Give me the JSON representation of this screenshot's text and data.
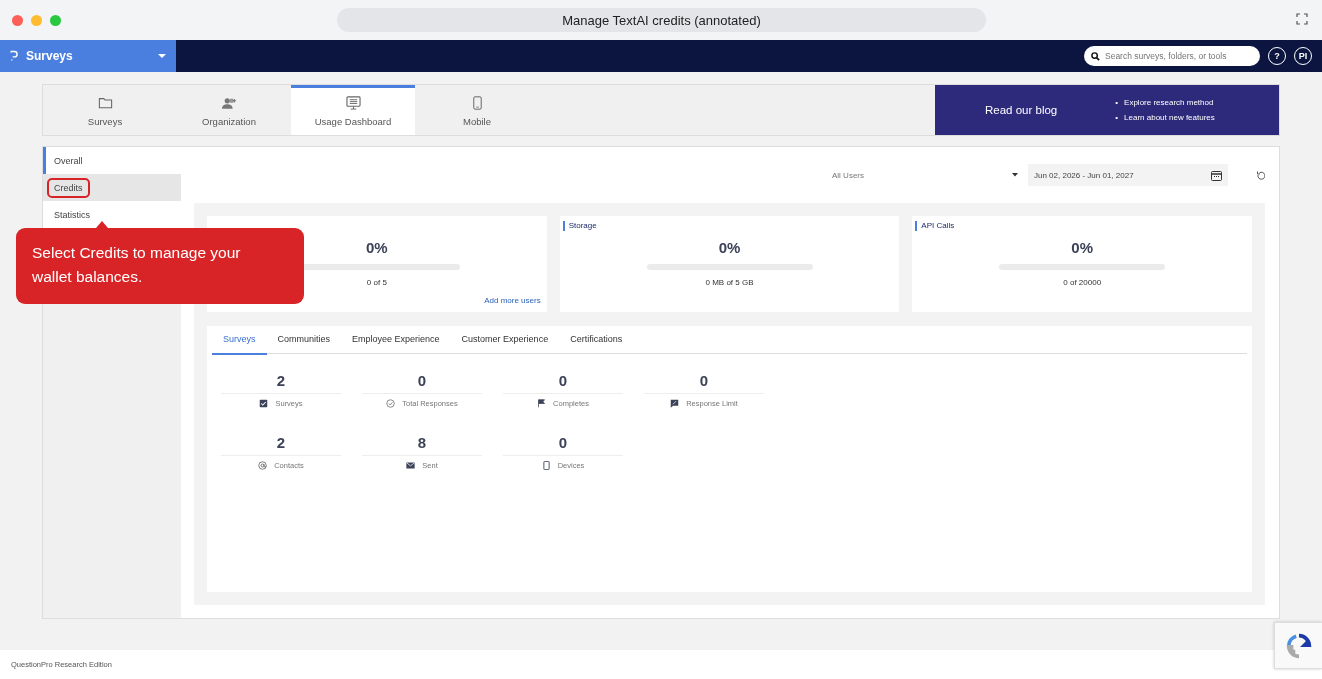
{
  "window": {
    "title": "Manage TextAI credits (annotated)"
  },
  "nav": {
    "product": "Surveys",
    "search_placeholder": "Search surveys, folders, or tools",
    "help": "?",
    "avatar": "PI"
  },
  "top_tabs": [
    {
      "label": "Surveys",
      "selected": false
    },
    {
      "label": "Organization",
      "selected": false
    },
    {
      "label": "Usage Dashboard",
      "selected": true
    },
    {
      "label": "Mobile",
      "selected": false
    }
  ],
  "blog_banner": {
    "title": "Read our blog",
    "bullet": "•",
    "points": [
      "Explore research method",
      "Learn about new features"
    ]
  },
  "sidebar": {
    "items": [
      {
        "label": "Overall",
        "selected": true,
        "highlighted": false
      },
      {
        "label": "Credits",
        "selected": false,
        "highlighted": true
      },
      {
        "label": "Statistics",
        "selected": false,
        "highlighted": false
      }
    ]
  },
  "filters": {
    "user_filter": "All Users",
    "date_range": "Jun 02, 2026 - Jun 01, 2027"
  },
  "usage_cards": [
    {
      "percent": "0%",
      "level": 0,
      "detail": "0 of 5",
      "link": "Add more users"
    },
    {
      "title": "Storage",
      "percent": "0%",
      "level": 0,
      "detail": "0 MB of 5 GB"
    },
    {
      "title": "API Calls",
      "percent": "0%",
      "level": 0,
      "detail": "0 of 20000"
    }
  ],
  "product_tabs": [
    {
      "label": "Surveys",
      "selected": true
    },
    {
      "label": "Communities",
      "selected": false
    },
    {
      "label": "Employee Experience",
      "selected": false
    },
    {
      "label": "Customer Experience",
      "selected": false
    },
    {
      "label": "Certifications",
      "selected": false
    }
  ],
  "stats": [
    [
      {
        "value": "2",
        "label": "Surveys"
      },
      {
        "value": "0",
        "label": "Total Responses"
      },
      {
        "value": "0",
        "label": "Completes"
      },
      {
        "value": "0",
        "label": "Response Limit"
      }
    ],
    [
      {
        "value": "2",
        "label": "Contacts"
      },
      {
        "value": "8",
        "label": "Sent"
      },
      {
        "value": "0",
        "label": "Devices"
      }
    ]
  ],
  "callout": {
    "text": "Select Credits to manage your wallet balances."
  },
  "footer": {
    "text": "QuestionPro Research Edition"
  }
}
